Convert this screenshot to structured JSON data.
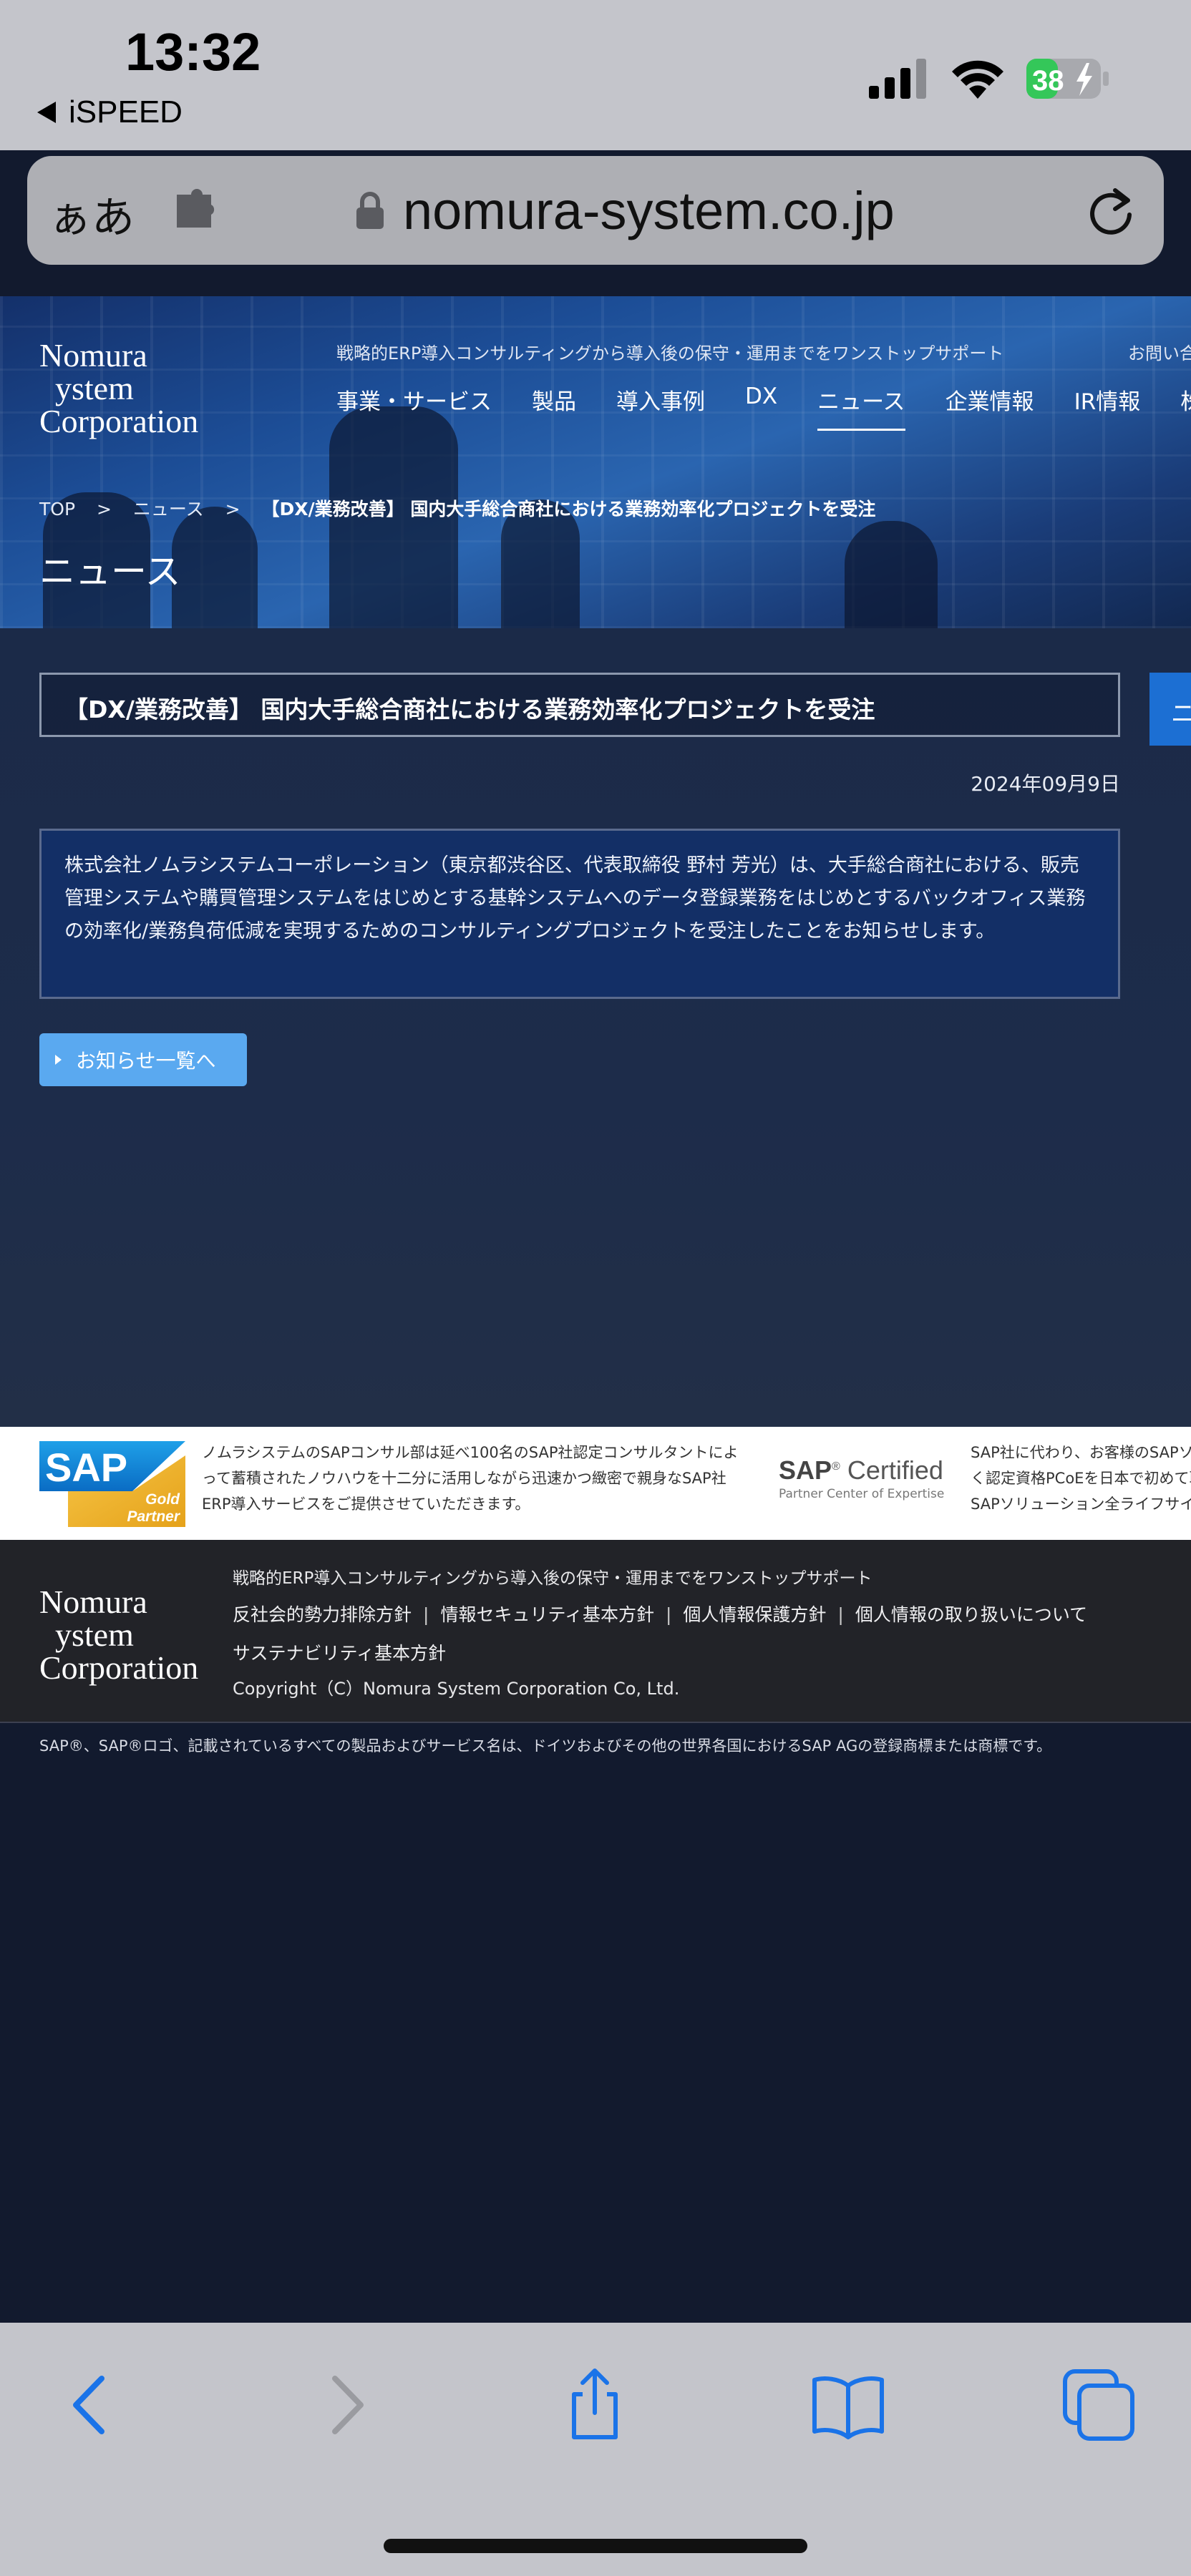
{
  "status_bar": {
    "time": "13:32",
    "back_app": "iSPEED",
    "battery": "38"
  },
  "address_bar": {
    "aa": "ぁあ",
    "url": "nomura-system.co.jp"
  },
  "site": {
    "logo": {
      "line1": "Nomura",
      "line2": "ystem",
      "line3": "Corporation"
    },
    "tagline": "戦略的ERP導入コンサルティングから導入後の保守・運用までをワンストップサポート",
    "contact": "お問い合",
    "nav": [
      "事業・サービス",
      "製品",
      "導入事例",
      "DX",
      "ニュース",
      "企業情報",
      "IR情報",
      "株主"
    ],
    "nav_active": "ニュース",
    "breadcrumb": {
      "top": "TOP",
      "sep": ">",
      "news": "ニュース",
      "current": "【DX/業務改善】 国内大手総合商社における業務効率化プロジェクトを受注"
    },
    "page_heading": "ニュース",
    "article": {
      "title": "【DX/業務改善】 国内大手総合商社における業務効率化プロジェクトを受注",
      "side_tab": "ニ",
      "date": "2024年09月9日",
      "body": "株式会社ノムラシステムコーポレーション（東京都渋谷区、代表取締役 野村 芳光）は、大手総合商社における、販売管理システムや購買管理システムをはじめとする基幹システムへのデータ登録業務をはじめとするバックオフィス業務の効率化/業務負荷低減を実現するためのコンサルティングプロジェクトを受注したことをお知らせします。",
      "back_button": "お知らせ一覧へ"
    },
    "sap": {
      "logo_text": "SAP",
      "badge_line1": "Gold",
      "badge_line2": "Partner",
      "text1": "ノムラシステムのSAPコンサル部は延べ100名のSAP社認定コンサルタントによって蓄積されたノウハウを十二分に活用しながら迅速かつ緻密で親身なSAP社ERP導入サービスをご提供させていただきます。",
      "cert_sap": "SAP",
      "cert_word": "Certified",
      "cert_sub": "Partner Center of Expertise",
      "text2_line1": "SAP社に代わり、お客様のSAPソ",
      "text2_line2": "く認定資格PCoEを日本で初めて取",
      "text2_line3": "SAPソリューション全ライフサイク"
    },
    "footer": {
      "tagline": "戦略的ERP導入コンサルティングから導入後の保守・運用までをワンストップサポート",
      "links": [
        "反社会的勢力排除方針",
        "情報セキュリティ基本方針",
        "個人情報保護方針",
        "個人情報の取り扱いについて",
        "サステナビリティ基本方針"
      ],
      "copyright": "Copyright（C）Nomura System Corporation Co, Ltd."
    },
    "disclaimer": "SAP®、SAP®ロゴ、記載されているすべての製品およびサービス名は、ドイツおよびその他の世界各国におけるSAP AGの登録商標または商標です。"
  },
  "toolbar": {
    "icons": [
      "back-icon",
      "forward-icon",
      "share-icon",
      "bookmarks-icon",
      "tabs-icon"
    ]
  },
  "colors": {
    "accent_blue": "#1a73e8",
    "hero_blue": "#1c4d96",
    "content_bg": "#1d2c4a",
    "news_body_bg": "#132f66",
    "button_blue": "#5aa9f0",
    "footer_bg": "#222328",
    "battery_green": "#34c759"
  }
}
